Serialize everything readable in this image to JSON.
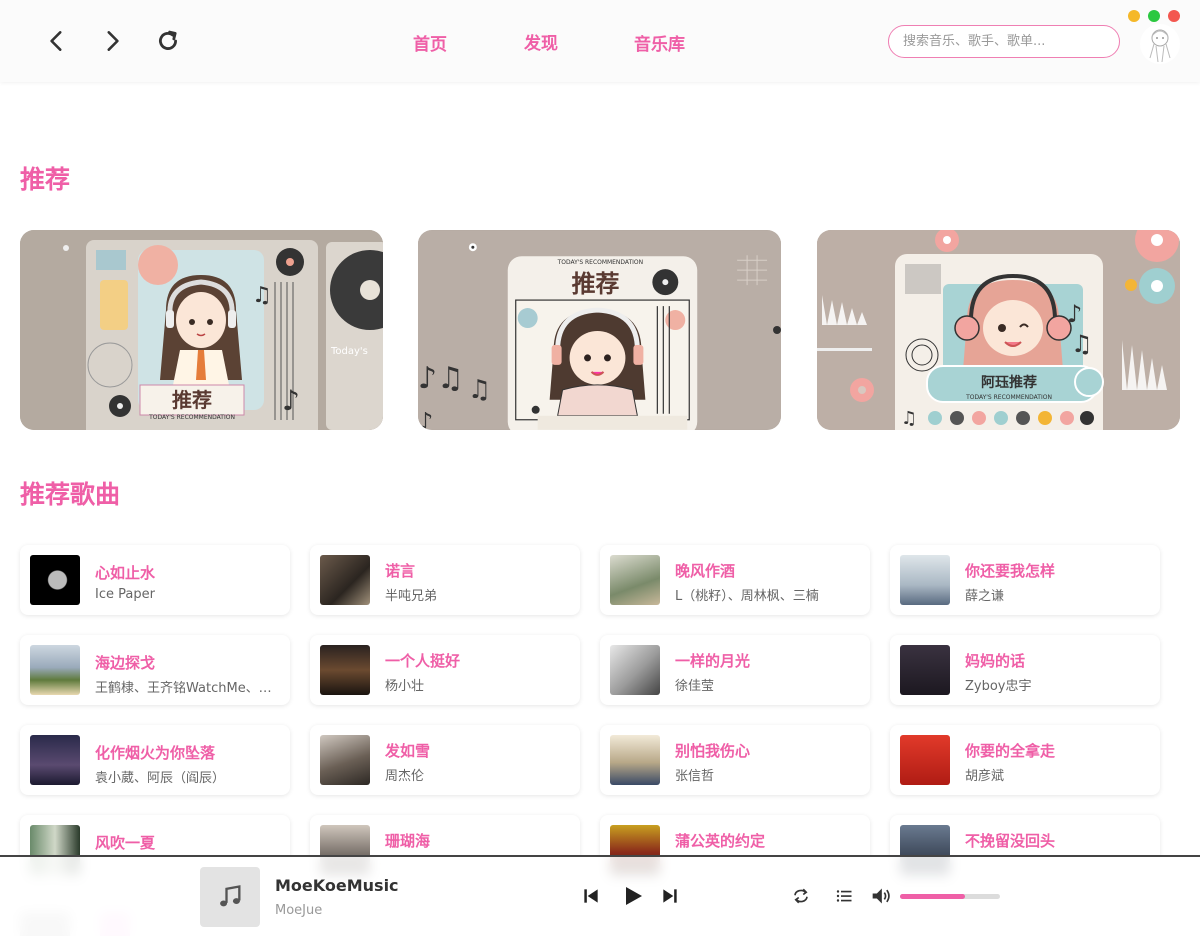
{
  "nav": {
    "tabs": [
      {
        "label": "首页"
      },
      {
        "label": "发现"
      },
      {
        "label": "音乐库"
      }
    ],
    "search_placeholder": "搜索音乐、歌手、歌单..."
  },
  "window_controls": {
    "minimize": "#f5b829",
    "maximize": "#2bc840",
    "close": "#f3574f"
  },
  "sections": {
    "recommend_title": "推荐",
    "songs_title": "推荐歌曲"
  },
  "banners": [
    {
      "title": "推荐",
      "subtitle": "TODAY'S RECOMMENDATION",
      "side_text": "Today's"
    },
    {
      "title": "推荐",
      "subtitle": "TODAY'S RECOMMENDATION"
    },
    {
      "title": "阿珏推荐",
      "subtitle": "TODAY'S RECOMMENDATION"
    }
  ],
  "songs": [
    {
      "title": "心如止水",
      "artist": "Ice Paper"
    },
    {
      "title": "诺言",
      "artist": "半吨兄弟"
    },
    {
      "title": "晚风作酒",
      "artist": "L（桃籽）、周林枫、三楠"
    },
    {
      "title": "你还要我怎样",
      "artist": "薛之谦"
    },
    {
      "title": "海边探戈",
      "artist": "王鹤棣、王齐铭WatchMe、…"
    },
    {
      "title": "一个人挺好",
      "artist": "杨小壮"
    },
    {
      "title": "一样的月光",
      "artist": "徐佳莹"
    },
    {
      "title": "妈妈的话",
      "artist": "Zyboy忠宇"
    },
    {
      "title": "化作烟火为你坠落",
      "artist": "袁小葳、阿辰（阎辰）"
    },
    {
      "title": "发如雪",
      "artist": "周杰伦"
    },
    {
      "title": "别怕我伤心",
      "artist": "张信哲"
    },
    {
      "title": "你要的全拿走",
      "artist": "胡彦斌"
    },
    {
      "title": "风吹一夏",
      "artist": ""
    },
    {
      "title": "珊瑚海",
      "artist": ""
    },
    {
      "title": "蒲公英的约定",
      "artist": ""
    },
    {
      "title": "不挽留没回头",
      "artist": ""
    }
  ],
  "player": {
    "title": "MoeKoeMusic",
    "artist": "MoeJue",
    "volume_percent": 65,
    "accent": "#ef5fa7"
  }
}
